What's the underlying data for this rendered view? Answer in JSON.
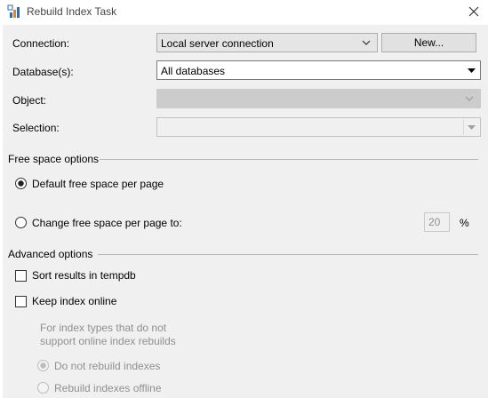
{
  "window": {
    "title": "Rebuild Index Task",
    "icon": "sql-task-icon",
    "close_icon": "close-icon"
  },
  "form": {
    "connection": {
      "label": "Connection:",
      "value": "Local server connection",
      "new_button": "New..."
    },
    "databases": {
      "label": "Database(s):",
      "value": "All databases"
    },
    "object": {
      "label": "Object:",
      "value": ""
    },
    "selection": {
      "label": "Selection:",
      "value": ""
    }
  },
  "free_space": {
    "title": "Free space options",
    "default_option": "Default free space per page",
    "change_option": "Change free space per page to:",
    "percent_value": "20",
    "percent_unit": "%",
    "selected": "default"
  },
  "advanced": {
    "title": "Advanced options",
    "sort_tempdb": "Sort results in tempdb",
    "sort_tempdb_checked": false,
    "keep_online": "Keep index online",
    "keep_online_checked": false,
    "note_line1": "For index types that do not",
    "note_line2": "support online index rebuilds",
    "do_not_rebuild": "Do not rebuild indexes",
    "rebuild_offline": "Rebuild indexes offline",
    "offline_selected": "do_not_rebuild"
  },
  "colors": {
    "background": "#f0f0f0",
    "disabled_text": "#8f8f8f",
    "border": "#adadad"
  }
}
